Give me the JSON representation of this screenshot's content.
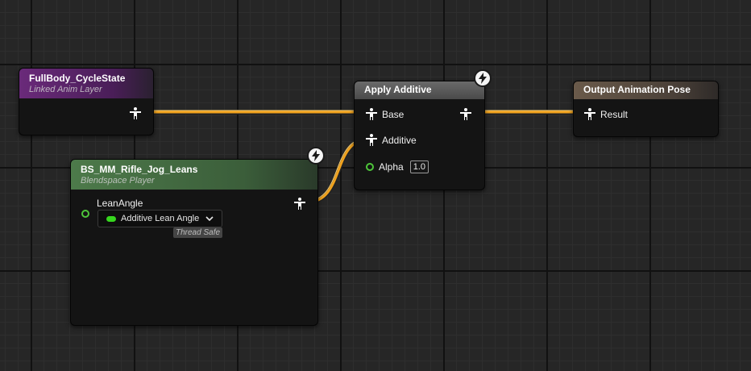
{
  "nodes": {
    "fullbody": {
      "title": "FullBody_CycleState",
      "subtitle": "Linked Anim Layer"
    },
    "apply_additive": {
      "title": "Apply Additive",
      "pins": {
        "base": "Base",
        "additive": "Additive",
        "alpha": "Alpha"
      },
      "alpha_value": "1.0"
    },
    "output_pose": {
      "title": "Output Animation Pose",
      "pins": {
        "result": "Result"
      }
    },
    "blendspace": {
      "title": "BS_MM_Rifle_Jog_Leans",
      "subtitle": "Blendspace Player",
      "pins": {
        "lean_angle": "LeanAngle"
      },
      "lean_dropdown": "Additive Lean Angle",
      "thread_safe": "Thread Safe"
    }
  },
  "colors": {
    "wire_pose": "#f0a21e",
    "header_linked_layer": "#6a2a7a",
    "header_blendspace": "#4a6e48",
    "float_pin": "#4ec63a"
  },
  "icons": [
    "pose-pin-icon",
    "lightning-bolt-icon",
    "float-pin-icon",
    "chevron-down-icon"
  ]
}
